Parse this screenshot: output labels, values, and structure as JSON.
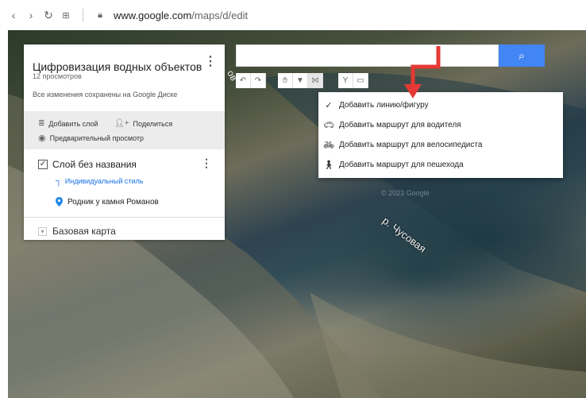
{
  "browser": {
    "url_domain": "www.google.com",
    "url_path": "/maps/d/edit"
  },
  "panel": {
    "title": "Цифровизация водных объектов",
    "views": "12 просмотров",
    "saved": "Все изменения сохранены на Google Диске",
    "add_layer": "Добавить слой",
    "share": "Поделиться",
    "preview": "Предварительный просмотр",
    "layer_name": "Слой без названия",
    "layer_style": "Индивидуальный стиль",
    "feature_name": "Родник у камня Романов",
    "basemap": "Базовая карта"
  },
  "menu": {
    "items": [
      {
        "label": "Добавить линию/фигуру",
        "icon": "checkmark-icon"
      },
      {
        "label": "Добавить маршрут для водителя",
        "icon": "car-icon"
      },
      {
        "label": "Добавить маршрут для велосипедиста",
        "icon": "bicycle-icon"
      },
      {
        "label": "Добавить маршрут для пешехода",
        "icon": "pedestrian-icon"
      }
    ]
  },
  "map": {
    "river_label": "р. Чусовая",
    "partial_label": "ов"
  },
  "colors": {
    "search_button": "#4285f4",
    "annotation_arrow": "#e53935",
    "style_link": "#1a73e8"
  }
}
